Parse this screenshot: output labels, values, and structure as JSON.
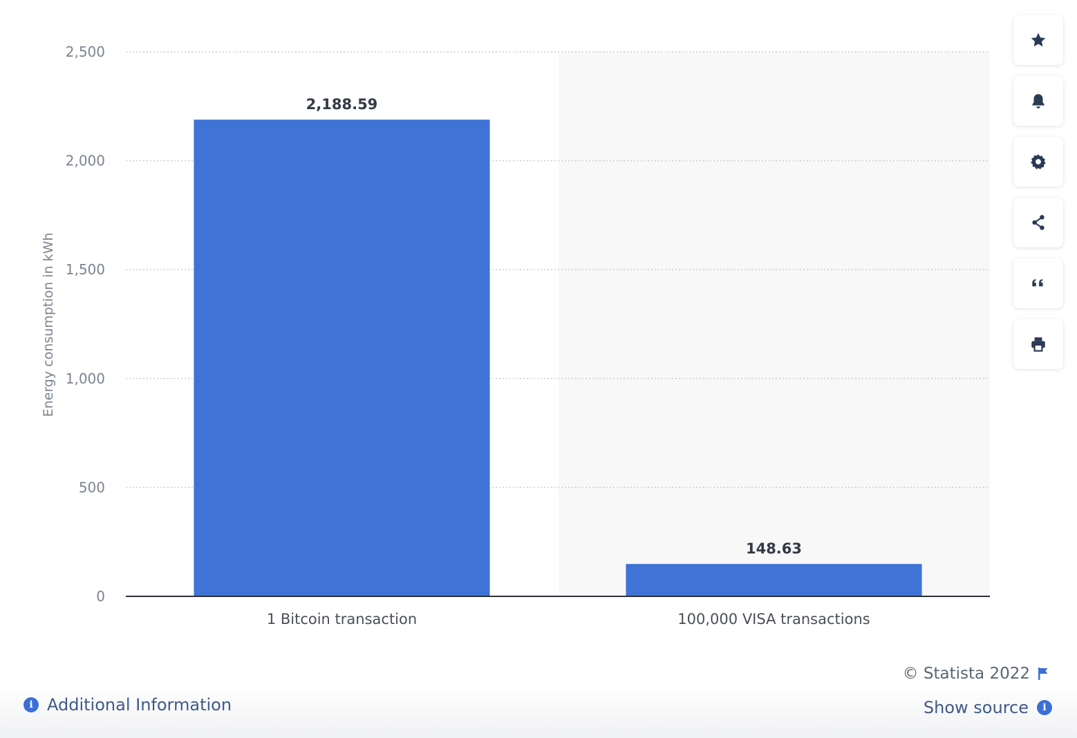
{
  "chart_data": {
    "type": "bar",
    "categories": [
      "1 Bitcoin transaction",
      "100,000 VISA transactions"
    ],
    "values": [
      2188.59,
      148.63
    ],
    "value_labels": [
      "2,188.59",
      "148.63"
    ],
    "ylabel": "Energy consumption in kWh",
    "xlabel": "",
    "ylim": [
      0,
      2500
    ],
    "yticks": [
      0,
      500,
      1000,
      1500,
      2000,
      2500
    ],
    "ytick_labels": [
      "0",
      "500",
      "1,000",
      "1,500",
      "2,000",
      "2,500"
    ],
    "grid": true,
    "bar_color": "#3f73d6"
  },
  "toolbar": {
    "items": [
      {
        "icon": "star-icon"
      },
      {
        "icon": "bell-icon"
      },
      {
        "icon": "gear-icon"
      },
      {
        "icon": "share-icon"
      },
      {
        "icon": "quote-icon"
      },
      {
        "icon": "print-icon"
      }
    ]
  },
  "footer": {
    "copyright": "© Statista 2022",
    "additional_info": "Additional Information",
    "show_source": "Show source"
  }
}
